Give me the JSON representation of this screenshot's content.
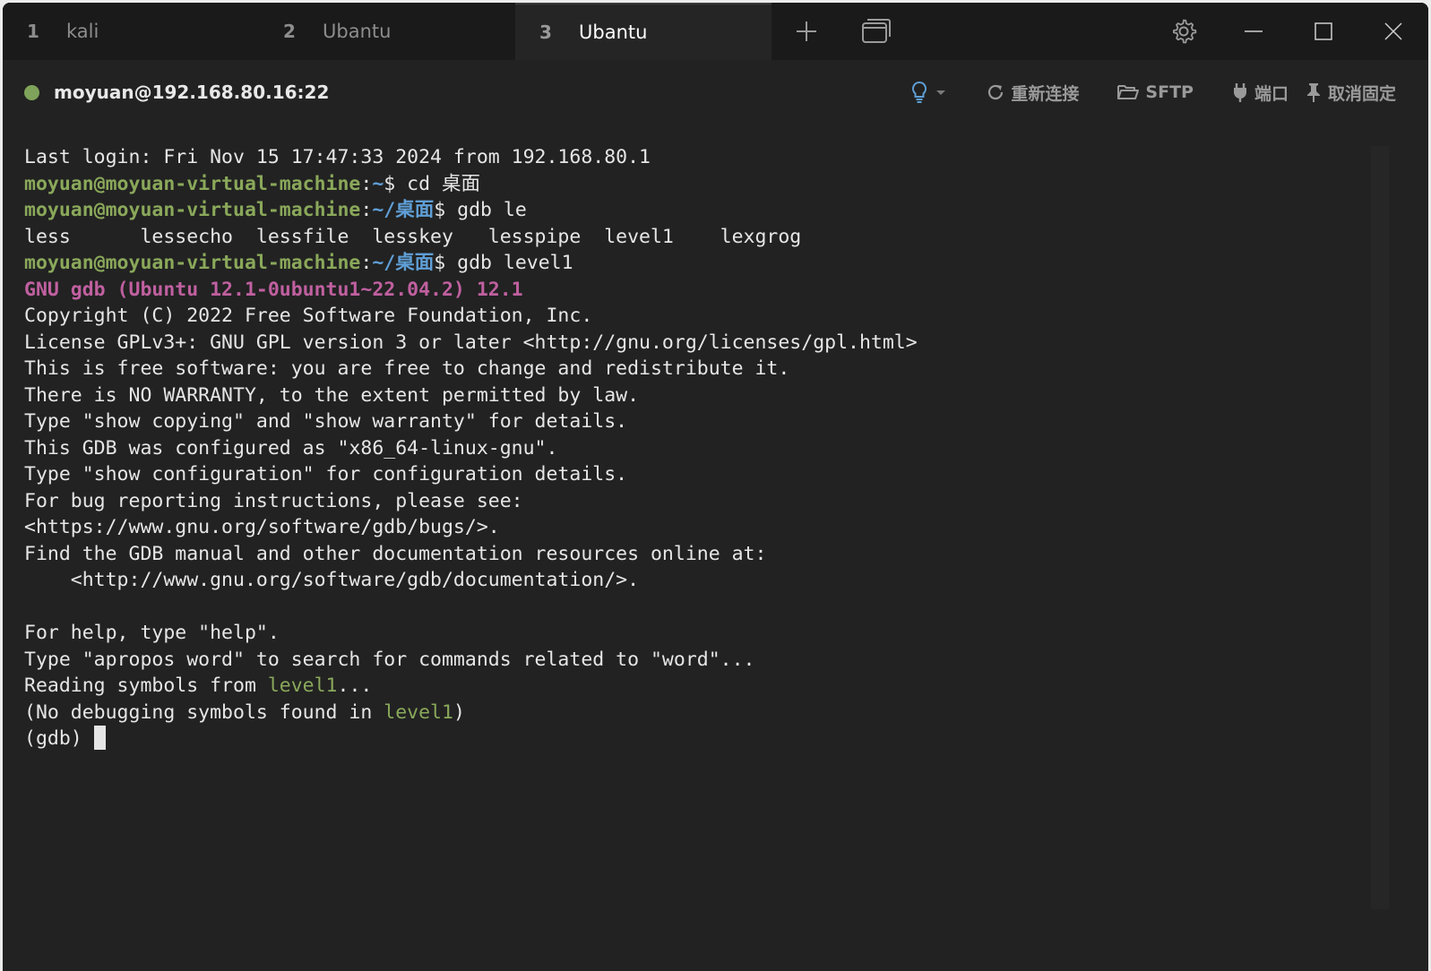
{
  "tabs": [
    {
      "num": "1",
      "name": "kali",
      "active": false
    },
    {
      "num": "2",
      "name": "Ubantu",
      "active": false
    },
    {
      "num": "3",
      "name": "Ubantu",
      "active": true
    }
  ],
  "session": {
    "host": "moyuan@192.168.80.16:22",
    "status_color": "#7fa35a",
    "reconnect_label": "重新连接",
    "sftp_label": "SFTP",
    "port_label": "端口",
    "unpin_label": "取消固定"
  },
  "terminal": {
    "lines": [
      [
        {
          "t": "Last login: Fri Nov 15 17:47:33 2024 from 192.168.80.1"
        }
      ],
      [
        {
          "t": "moyuan@moyuan-virtual-machine",
          "c": "green"
        },
        {
          "t": ":"
        },
        {
          "t": "~",
          "c": "blue"
        },
        {
          "t": "$ cd 桌面"
        }
      ],
      [
        {
          "t": "moyuan@moyuan-virtual-machine",
          "c": "green"
        },
        {
          "t": ":"
        },
        {
          "t": "~/桌面",
          "c": "blue"
        },
        {
          "t": "$ gdb le"
        }
      ],
      [
        {
          "t": "less      lessecho  lessfile  lesskey   lesspipe  level1    lexgrog"
        }
      ],
      [
        {
          "t": "moyuan@moyuan-virtual-machine",
          "c": "green"
        },
        {
          "t": ":"
        },
        {
          "t": "~/桌面",
          "c": "blue"
        },
        {
          "t": "$ gdb level1"
        }
      ],
      [
        {
          "t": "GNU gdb (Ubuntu 12.1-0ubuntu1~22.04.2) 12.1",
          "c": "magenta"
        }
      ],
      [
        {
          "t": "Copyright (C) 2022 Free Software Foundation, Inc."
        }
      ],
      [
        {
          "t": "License GPLv3+: GNU GPL version 3 or later <http://gnu.org/licenses/gpl.html>"
        }
      ],
      [
        {
          "t": "This is free software: you are free to change and redistribute it."
        }
      ],
      [
        {
          "t": "There is NO WARRANTY, to the extent permitted by law."
        }
      ],
      [
        {
          "t": "Type \"show copying\" and \"show warranty\" for details."
        }
      ],
      [
        {
          "t": "This GDB was configured as \"x86_64-linux-gnu\"."
        }
      ],
      [
        {
          "t": "Type \"show configuration\" for configuration details."
        }
      ],
      [
        {
          "t": "For bug reporting instructions, please see:"
        }
      ],
      [
        {
          "t": "<https://www.gnu.org/software/gdb/bugs/>."
        }
      ],
      [
        {
          "t": "Find the GDB manual and other documentation resources online at:"
        }
      ],
      [
        {
          "t": "    <http://www.gnu.org/software/gdb/documentation/>."
        }
      ],
      [
        {
          "t": ""
        }
      ],
      [
        {
          "t": "For help, type \"help\"."
        }
      ],
      [
        {
          "t": "Type \"apropos word\" to search for commands related to \"word\"..."
        }
      ],
      [
        {
          "t": "Reading symbols from "
        },
        {
          "t": "level1",
          "c": "olive"
        },
        {
          "t": "..."
        }
      ],
      [
        {
          "t": "(No debugging symbols found in "
        },
        {
          "t": "level1",
          "c": "olive"
        },
        {
          "t": ")"
        }
      ],
      [
        {
          "t": "(gdb) "
        },
        {
          "cursor": true
        }
      ]
    ]
  }
}
